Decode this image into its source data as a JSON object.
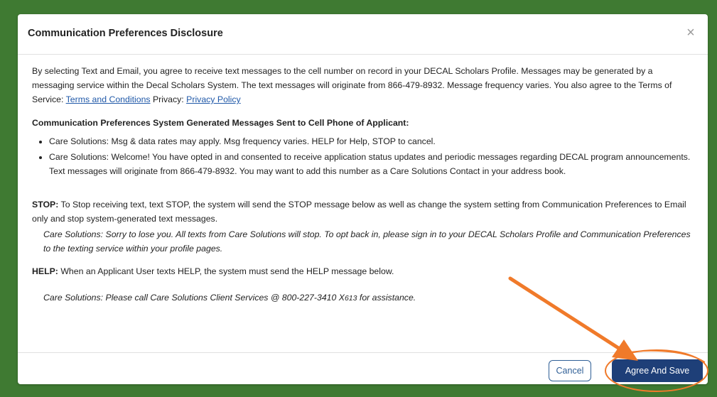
{
  "dialog": {
    "title": "Communication Preferences Disclosure",
    "close_glyph": "×",
    "intro": {
      "text_before_terms": "By selecting Text and Email, you agree to receive text messages to the cell number on record in your DECAL Scholars Profile. Messages may be generated by a messaging service within the Decal Scholars System. The text messages will originate from 866-479-8932. Message frequency varies. You also agree to the Terms of Service: ",
      "terms_link": "Terms and Conditions",
      "privacy_label": " Privacy: ",
      "privacy_link": "Privacy Policy"
    },
    "section_heading": "Communication Preferences System Generated Messages Sent to Cell Phone of Applicant:",
    "messages": [
      "Care Solutions: Msg & data rates may apply. Msg frequency varies. HELP for Help, STOP to cancel.",
      "Care Solutions: Welcome! You have opted in and consented to receive application status updates and periodic messages regarding DECAL program announcements. Text messages will originate from 866-479-8932. You may want to add this number as a Care Solutions Contact in your address book."
    ],
    "stop": {
      "label": "STOP:",
      "text": " To Stop receiving text, text STOP, the system will send the STOP message below as well as change the system setting from Communication Preferences to Email only and stop system-generated text messages.",
      "message": "Care Solutions: Sorry to lose you. All texts from Care Solutions will stop. To opt back in, please sign in to your DECAL Scholars Profile and Communication Preferences to the texting service within your profile pages."
    },
    "help": {
      "label": "HELP:",
      "text": " When an Applicant User texts HELP, the system must send the HELP message below.",
      "message_before_ext": "Care Solutions: Please call Care Solutions Client Services @ 800-227-3410 X",
      "ext": "613",
      "message_after_ext": "  for assistance."
    },
    "footer": {
      "cancel_label": "Cancel",
      "agree_label": "Agree And Save"
    }
  },
  "colors": {
    "background": "#3f7a32",
    "primary": "#1e3f78",
    "link": "#1f58a8",
    "annotation": "#f07a2a"
  },
  "icons": {
    "close": "close-icon"
  }
}
